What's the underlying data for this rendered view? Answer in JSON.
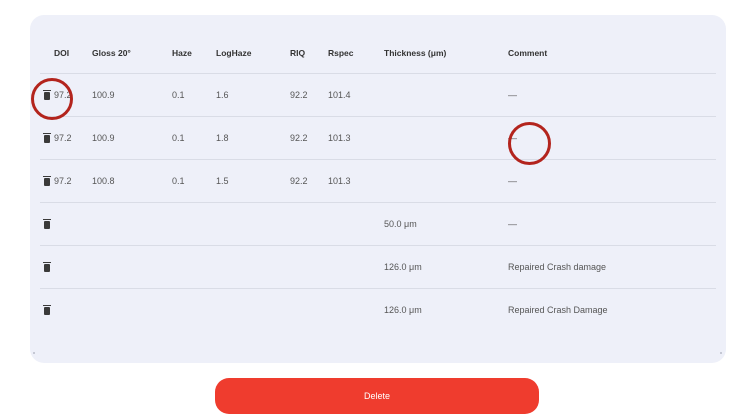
{
  "table": {
    "headers": [
      "DOI",
      "Gloss 20°",
      "Haze",
      "LogHaze",
      "RIQ",
      "Rspec",
      "Thickness (μm)",
      "Comment"
    ],
    "rows": [
      {
        "doi": "97.2",
        "gloss": "100.9",
        "haze": "0.1",
        "loghaze": "1.6",
        "riq": "92.2",
        "rspec": "101.4",
        "thickness": "",
        "comment": "—"
      },
      {
        "doi": "97.2",
        "gloss": "100.9",
        "haze": "0.1",
        "loghaze": "1.8",
        "riq": "92.2",
        "rspec": "101.3",
        "thickness": "",
        "comment": "—"
      },
      {
        "doi": "97.2",
        "gloss": "100.8",
        "haze": "0.1",
        "loghaze": "1.5",
        "riq": "92.2",
        "rspec": "101.3",
        "thickness": "",
        "comment": "—"
      },
      {
        "doi": "",
        "gloss": "",
        "haze": "",
        "loghaze": "",
        "riq": "",
        "rspec": "",
        "thickness": "50.0 μm",
        "comment": "—"
      },
      {
        "doi": "",
        "gloss": "",
        "haze": "",
        "loghaze": "",
        "riq": "",
        "rspec": "",
        "thickness": "126.0 μm",
        "comment": "Repaired Crash damage"
      },
      {
        "doi": "",
        "gloss": "",
        "haze": "",
        "loghaze": "",
        "riq": "",
        "rspec": "",
        "thickness": "126.0 μm",
        "comment": "Repaired Crash Damage"
      }
    ]
  },
  "actions": {
    "delete_label": "Delete"
  },
  "colors": {
    "panel_bg": "#eef0f9",
    "delete_bg": "#ef3c2e",
    "highlight_ring": "#b3241d"
  },
  "icons": {
    "row_action": "trash-icon"
  }
}
